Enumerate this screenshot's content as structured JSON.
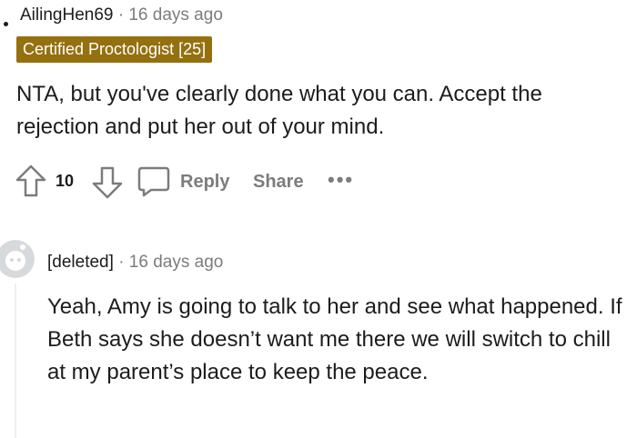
{
  "comment1": {
    "username": "AilingHen69",
    "separator": "·",
    "timestamp": "16 days ago",
    "flair": "Certified Proctologist [25]",
    "body": "NTA, but you've clearly done what you can. Accept the rejection and put her out of your mind.",
    "actions": {
      "upvote_icon": "arrow-up-icon",
      "vote_count": "10",
      "downvote_icon": "arrow-down-icon",
      "reply_icon": "speech-bubble-icon",
      "reply_label": "Reply",
      "share_label": "Share",
      "more_label": "•••"
    }
  },
  "comment2": {
    "username": "[deleted]",
    "separator": "·",
    "timestamp": "16 days ago",
    "avatar_icon": "default-avatar-icon",
    "body": "Yeah, Amy is going to talk to her and see what happened. If Beth says she doesn’t want me there we will switch to chill at my parent’s place to keep the peace."
  },
  "colors": {
    "flair_bg": "#94700f",
    "meta_gray": "#7c7c7c",
    "text": "#1c1c1c"
  }
}
